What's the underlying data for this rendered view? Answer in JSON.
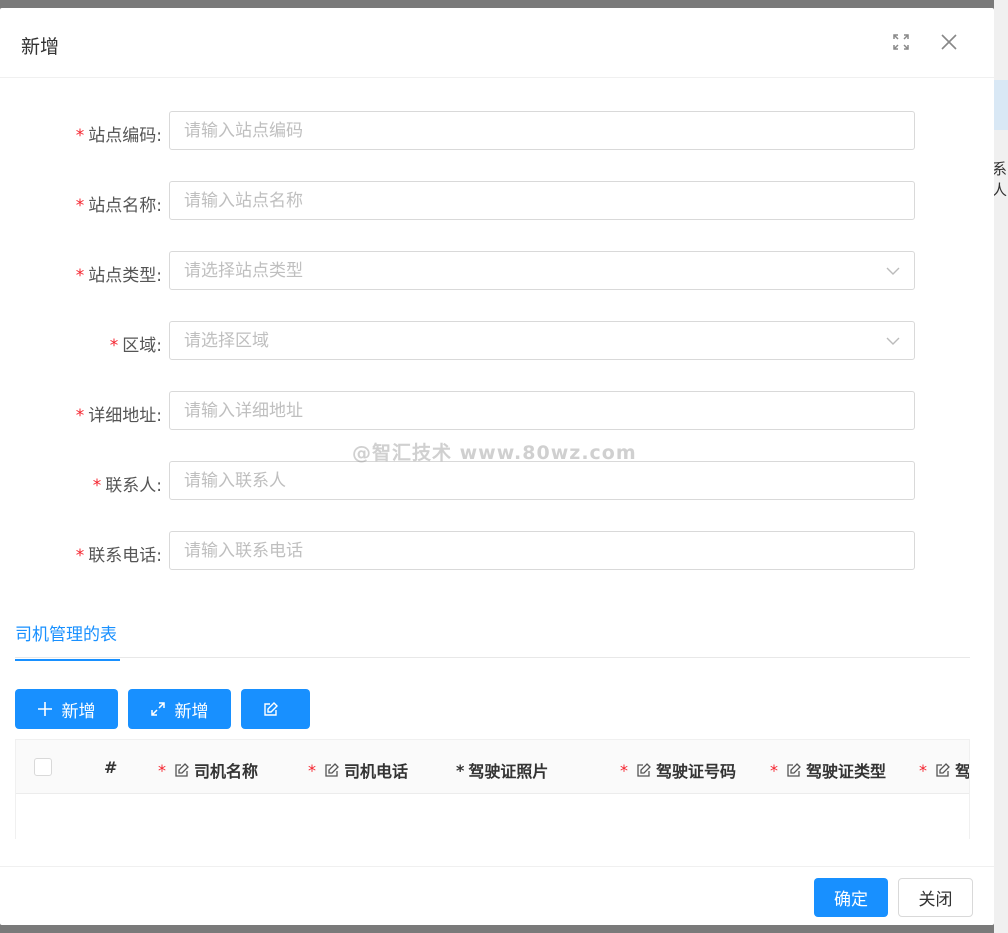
{
  "background": {
    "partial_text": "系人"
  },
  "dialog": {
    "title": "新增",
    "icons": {
      "fullscreen": "fullscreen-icon",
      "close": "close-icon"
    }
  },
  "form": {
    "required_mark": "*",
    "fields": [
      {
        "label": "站点编码",
        "placeholder": "请输入站点编码",
        "type": "input"
      },
      {
        "label": "站点名称",
        "placeholder": "请输入站点名称",
        "type": "input"
      },
      {
        "label": "站点类型",
        "placeholder": "请选择站点类型",
        "type": "select"
      },
      {
        "label": "区域",
        "placeholder": "请选择区域",
        "type": "select"
      },
      {
        "label": "详细地址",
        "placeholder": "请输入详细地址",
        "type": "input"
      },
      {
        "label": "联系人",
        "placeholder": "请输入联系人",
        "type": "input"
      },
      {
        "label": "联系电话",
        "placeholder": "请输入联系电话",
        "type": "input"
      }
    ]
  },
  "watermark": "@智汇技术 www.80wz.com",
  "tabs": [
    {
      "label": "司机管理的表",
      "active": true
    }
  ],
  "toolbar": {
    "add_label": "新增",
    "expand_add_label": "新增",
    "edit_label": ""
  },
  "table": {
    "columns": [
      {
        "label": "#",
        "required": false,
        "editable": false
      },
      {
        "label": "司机名称",
        "required": true,
        "editable": true
      },
      {
        "label": "司机电话",
        "required": true,
        "editable": true
      },
      {
        "label": "驾驶证照片",
        "required": true,
        "editable": false
      },
      {
        "label": "驾驶证号码",
        "required": true,
        "editable": true
      },
      {
        "label": "驾驶证类型",
        "required": true,
        "editable": true
      },
      {
        "label": "驾",
        "required": true,
        "editable": true
      }
    ],
    "rows": []
  },
  "footer": {
    "ok_label": "确定",
    "cancel_label": "关闭"
  },
  "colors": {
    "primary": "#1890ff",
    "required": "#f5222d",
    "border": "#d9d9d9"
  }
}
